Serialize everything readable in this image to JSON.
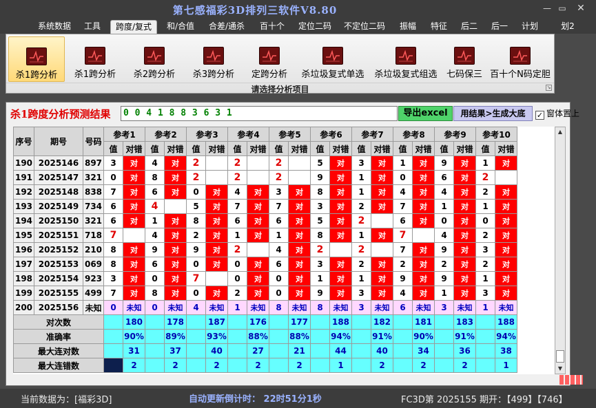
{
  "window": {
    "title": "第七感福彩3D排列三软件V8.80",
    "extra": "划2"
  },
  "menu": [
    "系统数据",
    "工具",
    "跨度/复式",
    "和/合值",
    "合差/通杀",
    "百十个",
    "定位二码",
    "不定位二码",
    "振幅",
    "特征",
    "后二",
    "后一",
    "计划"
  ],
  "ribbon": {
    "buttons": [
      "杀1跨分析",
      "杀1跨分析",
      "杀2跨分析",
      "杀3跨分析",
      "定跨分析",
      "杀垃圾复式单选",
      "杀垃圾复式组选",
      "七码保三",
      "百十个N码定胆"
    ],
    "caption": "请选择分析项目"
  },
  "panel": {
    "heading": "杀1跨度分析预测结果",
    "result": "0 0 4 1 8 8 3 6 3 1",
    "excel_label": "导出excel",
    "generate_label": "用结果>生成大底",
    "topmost_label": "窗体置上",
    "topmost_mark": "✓"
  },
  "table": {
    "headers": {
      "index": "序号",
      "period": "期号",
      "number": "号码",
      "value": "值",
      "result": "对错"
    },
    "refs": [
      "参考1",
      "参考2",
      "参考3",
      "参考4",
      "参考5",
      "参考6",
      "参考7",
      "参考8",
      "参考9",
      "参考10"
    ],
    "rows": [
      {
        "idx": "190",
        "period": "2025146",
        "num": "897",
        "vals": [
          "3",
          "4",
          "2",
          "2",
          "2",
          "5",
          "3",
          "1",
          "9",
          "1"
        ]
      },
      {
        "idx": "191",
        "period": "2025147",
        "num": "321",
        "vals": [
          "0",
          "8",
          "2",
          "2",
          "2",
          "9",
          "1",
          "0",
          "6",
          "2"
        ]
      },
      {
        "idx": "192",
        "period": "2025148",
        "num": "838",
        "vals": [
          "7",
          "6",
          "0",
          "4",
          "3",
          "8",
          "1",
          "4",
          "4",
          "2"
        ]
      },
      {
        "idx": "193",
        "period": "2025149",
        "num": "734",
        "vals": [
          "6",
          "4",
          "5",
          "7",
          "7",
          "3",
          "2",
          "7",
          "1",
          "1"
        ]
      },
      {
        "idx": "194",
        "period": "2025150",
        "num": "321",
        "vals": [
          "6",
          "1",
          "8",
          "6",
          "6",
          "5",
          "2",
          "6",
          "0",
          "0"
        ]
      },
      {
        "idx": "195",
        "period": "2025151",
        "num": "718",
        "vals": [
          "7",
          "4",
          "2",
          "1",
          "1",
          "8",
          "1",
          "7",
          "4",
          "2"
        ]
      },
      {
        "idx": "196",
        "period": "2025152",
        "num": "210",
        "vals": [
          "8",
          "9",
          "9",
          "2",
          "4",
          "2",
          "2",
          "7",
          "9",
          "3"
        ]
      },
      {
        "idx": "197",
        "period": "2025153",
        "num": "069",
        "vals": [
          "8",
          "6",
          "0",
          "0",
          "6",
          "3",
          "2",
          "2",
          "2",
          "2"
        ]
      },
      {
        "idx": "198",
        "period": "2025154",
        "num": "923",
        "vals": [
          "3",
          "0",
          "7",
          "0",
          "0",
          "1",
          "1",
          "9",
          "9",
          "1"
        ]
      },
      {
        "idx": "199",
        "period": "2025155",
        "num": "499",
        "vals": [
          "7",
          "8",
          "0",
          "2",
          "0",
          "9",
          "3",
          "4",
          "1",
          "3"
        ]
      },
      {
        "idx": "200",
        "period": "2025156",
        "num": "未知",
        "vals": [
          "0",
          "0",
          "4",
          "1",
          "8",
          "8",
          "3",
          "6",
          "3",
          "1"
        ]
      }
    ],
    "unknown_label": "未知",
    "hit_label": "对",
    "stats": [
      {
        "label": "对次数",
        "values": [
          "180",
          "178",
          "187",
          "176",
          "177",
          "188",
          "182",
          "181",
          "183",
          "188"
        ]
      },
      {
        "label": "准确率",
        "values": [
          "90%",
          "89%",
          "93%",
          "88%",
          "88%",
          "94%",
          "91%",
          "90%",
          "91%",
          "94%"
        ]
      },
      {
        "label": "最大连对数",
        "values": [
          "31",
          "37",
          "40",
          "27",
          "21",
          "44",
          "40",
          "34",
          "36",
          "38"
        ]
      },
      {
        "label": "最大连错数",
        "values": [
          "2",
          "2",
          "2",
          "2",
          "2",
          "1",
          "2",
          "2",
          "2",
          "1"
        ]
      }
    ]
  },
  "status": {
    "current": "当前数据为：[福彩3D]",
    "countdown": "自动更新倒计时：  22时51分1秒",
    "draw": "FC3D第 2025155 期开：【499】【746】"
  }
}
